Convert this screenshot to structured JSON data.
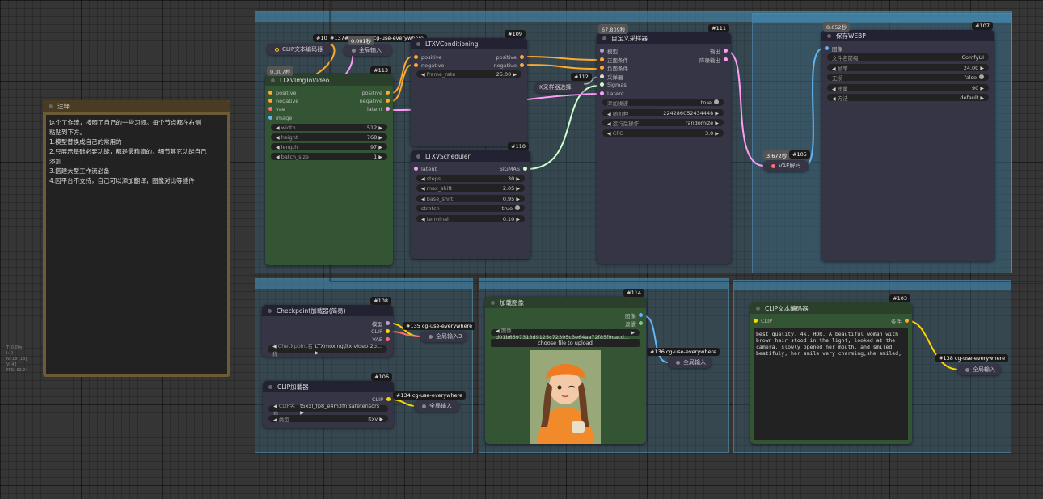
{
  "colors": {
    "clip": "#ffd500",
    "conditioning": "#ffa931",
    "model": "#b39ddb",
    "vae": "#ff6e6e",
    "latent": "#ff9cf9",
    "image": "#64b5f6",
    "sigmas": "#cdffcd"
  },
  "note": {
    "title": "注释",
    "lines": [
      "这个工作流，按照了自己的一些习惯。每个节点都在右侧",
      "粘贴到下方。",
      "1.模型替换成自己的常用的",
      "2.只展示基础必要功能，都是最精简的，细节其它功能自己",
      "添加",
      "3.搭建大型工作流必备",
      "4.因平台不支持，自己可以添加翻译，图像对比等插件"
    ]
  },
  "side_info": [
    "T: 0.00s",
    "I: 0",
    "N: 18 [18]",
    "V: 43",
    "FPS: 62.04"
  ],
  "n104": {
    "id": "#104",
    "title": "CLIP文本编码器"
  },
  "n137": {
    "id": "#137",
    "label": "cg-use-everywhere",
    "time": "0.001秒",
    "title": "全局输入"
  },
  "n113": {
    "id": "#113",
    "time": "0.307秒",
    "title": "LTXVImgToVideo",
    "inputs": [
      "positive",
      "negative",
      "vae",
      "image"
    ],
    "outputs": [
      "positive",
      "negative",
      "latent"
    ],
    "widgets": [
      {
        "label": "width",
        "value": "512"
      },
      {
        "label": "height",
        "value": "768"
      },
      {
        "label": "length",
        "value": "97"
      },
      {
        "label": "batch_size",
        "value": "1"
      }
    ]
  },
  "n109": {
    "id": "#109",
    "title": "LTXVConditioning",
    "inputs": [
      "positive",
      "negative"
    ],
    "outputs": [
      "positive",
      "negative"
    ],
    "widgets": [
      {
        "label": "frame_rate",
        "value": "25.00"
      }
    ]
  },
  "n112": {
    "id": "#112",
    "title": "K采样器选择"
  },
  "n110": {
    "id": "#110",
    "title": "LTXVScheduler",
    "input": "latent",
    "output": "SIGMAS",
    "widgets": [
      {
        "label": "steps",
        "value": "30"
      },
      {
        "label": "max_shift",
        "value": "2.05"
      },
      {
        "label": "base_shift",
        "value": "0.95"
      },
      {
        "label": "stretch",
        "value": "true"
      },
      {
        "label": "terminal",
        "value": "0.10"
      }
    ]
  },
  "n111": {
    "id": "#111",
    "time": "67.809秒",
    "title": "自定义采样器",
    "inputs": [
      "模型",
      "正面条件",
      "负面条件",
      "采样器",
      "Sigmas",
      "Latent"
    ],
    "outputs": [
      "输出",
      "降噪输出"
    ],
    "widgets": [
      {
        "label": "添加噪波",
        "value": "true"
      },
      {
        "label": "随机种",
        "value": "224286052434448"
      },
      {
        "label": "运行后操作",
        "value": "randomize"
      },
      {
        "label": "CFG",
        "value": "3.0"
      }
    ]
  },
  "n107": {
    "id": "#107",
    "time": "8.652秒",
    "title": "保存WEBP",
    "input": "图像",
    "widgets": [
      {
        "label": "文件名前缀",
        "value": "ComfyUI"
      },
      {
        "label": "帧率",
        "value": "24.00"
      },
      {
        "label": "无损",
        "value": "false"
      },
      {
        "label": "质量",
        "value": "90"
      },
      {
        "label": "方法",
        "value": "default"
      }
    ]
  },
  "n105": {
    "id": "#105",
    "time": "3.672秒",
    "title": "VAE解码"
  },
  "n108": {
    "id": "#108",
    "title": "Checkpoint加载器(简易)",
    "outputs": [
      "模型",
      "CLIP",
      "VAE"
    ],
    "widget": {
      "label": "Checkpoint名称",
      "value": "LTXmoxing\\ltx-video-2b..."
    }
  },
  "n135": {
    "label": "#135 cg-use-everywhere",
    "title": "全局输入3"
  },
  "n106": {
    "id": "#106",
    "title": "CLIP加载器",
    "output": "CLIP",
    "widgets": [
      {
        "label": "CLIP名称",
        "value": "t5xxl_fp8_e4m3fn.safetensors"
      },
      {
        "label": "类型",
        "value": "ltxv"
      }
    ]
  },
  "n134": {
    "label": "#134 cg-use-everywhere",
    "title": "全局输入"
  },
  "n114": {
    "id": "#114",
    "title": "加载图像",
    "outputs": [
      "图像",
      "遮罩"
    ],
    "widget": {
      "label": "图像",
      "value": "d01b6697313d9125c72395c3e64aa72f85f9cacd..."
    },
    "upload": "choose file to upload"
  },
  "n136": {
    "label": "#136 cg-use-everywhere",
    "title": "全局输入"
  },
  "n103": {
    "id": "#103",
    "title": "CLIP文本编码器",
    "input": "CLIP",
    "output": "条件",
    "text": "best quality, 4k, HDR, A beautiful woman with brown hair stood in the light, looked at the camera, slowly opened her mouth, and smiled beatifuly, her smile very charming,she smiled,"
  },
  "n138": {
    "label": "#138 cg-use-everywhere",
    "title": "全局输入"
  }
}
